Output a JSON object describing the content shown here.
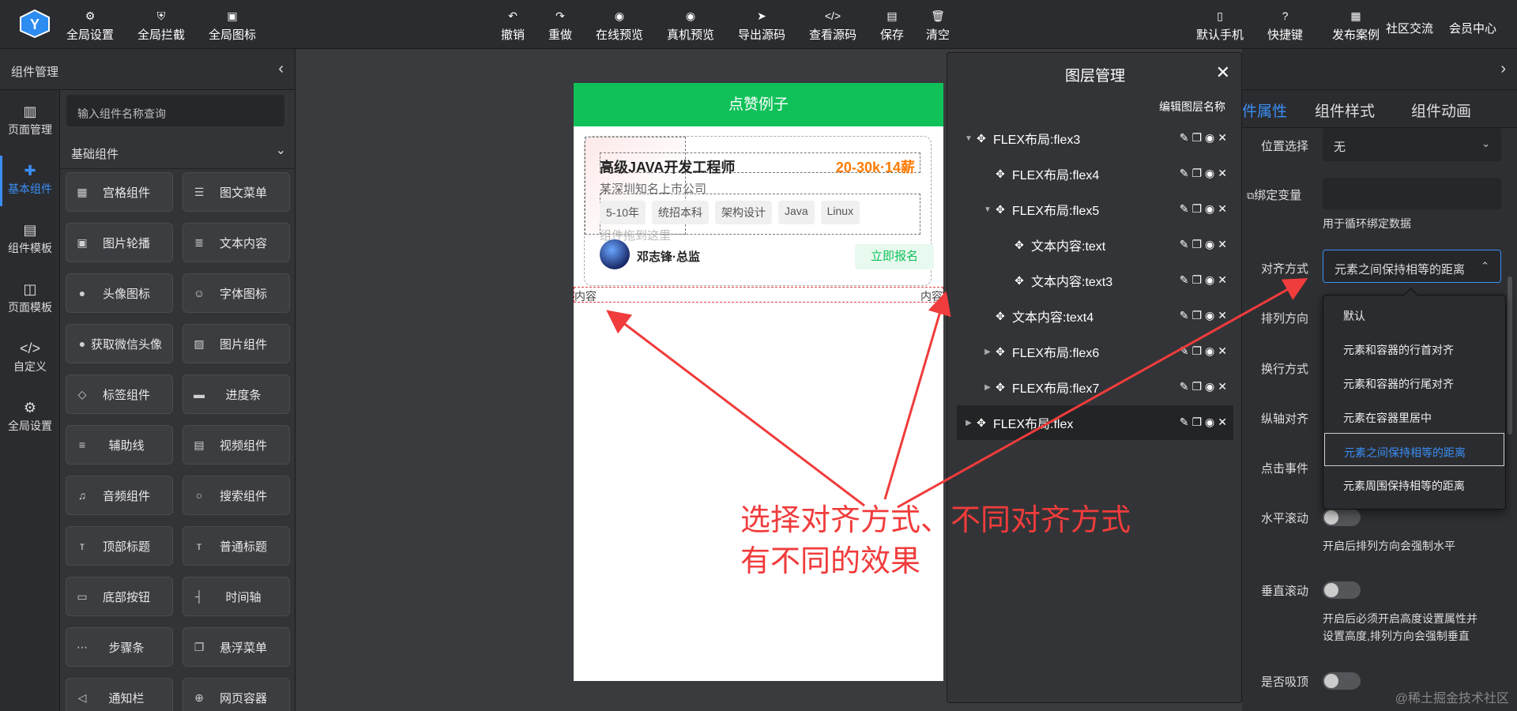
{
  "toolbar": {
    "left": [
      {
        "label": "全局设置",
        "icon": "settings-file-icon"
      },
      {
        "label": "全局拦截",
        "icon": "shield-icon"
      },
      {
        "label": "全局图标",
        "icon": "icon-library-icon"
      }
    ],
    "center": [
      {
        "label": "撤销",
        "icon": "undo-icon"
      },
      {
        "label": "重做",
        "icon": "redo-icon"
      },
      {
        "label": "在线预览",
        "icon": "eye-icon"
      },
      {
        "label": "真机预览",
        "icon": "eye-icon"
      },
      {
        "label": "导出源码",
        "icon": "send-icon"
      },
      {
        "label": "查看源码",
        "icon": "code-icon"
      },
      {
        "label": "保存",
        "icon": "save-icon"
      },
      {
        "label": "清空",
        "icon": "trash-icon"
      }
    ],
    "right": [
      {
        "label": "默认手机",
        "icon": "phone-icon"
      },
      {
        "label": "快捷键",
        "icon": "help-icon"
      },
      {
        "label": "发布案例",
        "icon": "publish-icon"
      },
      {
        "label": "社区交流",
        "icon": ""
      },
      {
        "label": "会员中心",
        "icon": ""
      }
    ]
  },
  "left_panel": {
    "title": "组件管理",
    "search_placeholder": "输入组件名称查询",
    "group": "基础组件",
    "nav": [
      {
        "label": "页面管理",
        "icon": "layout-icon",
        "active": false
      },
      {
        "label": "基本组件",
        "icon": "puzzle-icon",
        "active": true
      },
      {
        "label": "组件模板",
        "icon": "template-icon",
        "active": false
      },
      {
        "label": "页面模板",
        "icon": "database-icon",
        "active": false
      },
      {
        "label": "自定义",
        "icon": "code-icon",
        "active": false
      },
      {
        "label": "全局设置",
        "icon": "gear-icon",
        "active": false
      }
    ],
    "components": [
      {
        "label": "宫格组件",
        "glyph": "▦"
      },
      {
        "label": "图文菜单",
        "glyph": "☰"
      },
      {
        "label": "图片轮播",
        "glyph": "▣"
      },
      {
        "label": "文本内容",
        "glyph": "≣"
      },
      {
        "label": "头像图标",
        "glyph": "●"
      },
      {
        "label": "字体图标",
        "glyph": "☺"
      },
      {
        "label": "获取微信头像",
        "glyph": "●"
      },
      {
        "label": "图片组件",
        "glyph": "▨"
      },
      {
        "label": "标签组件",
        "glyph": "◇"
      },
      {
        "label": "进度条",
        "glyph": "▬"
      },
      {
        "label": "辅助线",
        "glyph": "≡"
      },
      {
        "label": "视频组件",
        "glyph": "▤"
      },
      {
        "label": "音频组件",
        "glyph": "♫"
      },
      {
        "label": "搜索组件",
        "glyph": "○"
      },
      {
        "label": "顶部标题",
        "glyph": "ᴛ"
      },
      {
        "label": "普通标题",
        "glyph": "ᴛ"
      },
      {
        "label": "底部按钮",
        "glyph": "▭"
      },
      {
        "label": "时间轴",
        "glyph": "┤"
      },
      {
        "label": "步骤条",
        "glyph": "⋯"
      },
      {
        "label": "悬浮菜单",
        "glyph": "❐"
      },
      {
        "label": "通知栏",
        "glyph": "◁"
      },
      {
        "label": "网页容器",
        "glyph": "⊕"
      }
    ]
  },
  "phone": {
    "header": "点赞例子",
    "job_title": "高级JAVA开发工程师",
    "salary": "20-30k·14薪",
    "company": "某深圳知名上市公司",
    "tags": [
      "5-10年",
      "统招本科",
      "架构设计",
      "Java",
      "Linux"
    ],
    "drop_hint": "组件拖到这里",
    "hr_name": "邓志锋·总监",
    "apply": "立即报名",
    "text_left": "内容",
    "text_right": "内容"
  },
  "layers": {
    "title": "图层管理",
    "edit_name": "编辑图层名称",
    "items": [
      {
        "label": "FLEX布局:flex3",
        "caret": "▼",
        "selected": false
      },
      {
        "label": "FLEX布局:flex4",
        "caret": "",
        "selected": false
      },
      {
        "label": "FLEX布局:flex5",
        "caret": "▼",
        "selected": false
      },
      {
        "label": "文本内容:text",
        "caret": "",
        "selected": false
      },
      {
        "label": "文本内容:text3",
        "caret": "",
        "selected": false
      },
      {
        "label": "文本内容:text4",
        "caret": "",
        "selected": false
      },
      {
        "label": "FLEX布局:flex6",
        "caret": "▶",
        "selected": false
      },
      {
        "label": "FLEX布局:flex7",
        "caret": "▶",
        "selected": false
      },
      {
        "label": "FLEX布局:flex",
        "caret": "▶",
        "selected": true
      }
    ]
  },
  "props": {
    "tabs": [
      "件属性",
      "组件样式",
      "组件动画"
    ],
    "position_label": "位置选择",
    "position_value": "无",
    "bind_label": "绑定变量",
    "bind_note": "用于循环绑定数据",
    "align_label": "对齐方式",
    "align_value": "元素之间保持相等的距离",
    "direction_label": "排列方向",
    "wrap_label": "换行方式",
    "cross_label": "纵轴对齐",
    "click_label": "点击事件",
    "hscroll_label": "水平滚动",
    "hscroll_note": "开启后排列方向会强制水平",
    "vscroll_label": "垂直滚动",
    "vscroll_note_1": "开启后必须开启高度设置属性并",
    "vscroll_note_2": "设置高度,排列方向会强制垂直",
    "sticky_label": "是否吸顶"
  },
  "align_options": [
    {
      "label": "默认",
      "selected": false
    },
    {
      "label": "元素和容器的行首对齐",
      "selected": false
    },
    {
      "label": "元素和容器的行尾对齐",
      "selected": false
    },
    {
      "label": "元素在容器里居中",
      "selected": false
    },
    {
      "label": "元素之间保持相等的距离",
      "selected": true
    },
    {
      "label": "元素周围保持相等的距离",
      "selected": false
    }
  ],
  "annotation": {
    "line1": "选择对齐方式、不同对齐方式",
    "line2": "有不同的效果",
    "color": "#f03c3c"
  },
  "watermark": "@稀土掘金技术社区",
  "colors": {
    "accent": "#3a8ef6",
    "header_green": "#10c15a",
    "salary": "#ff7a00"
  }
}
